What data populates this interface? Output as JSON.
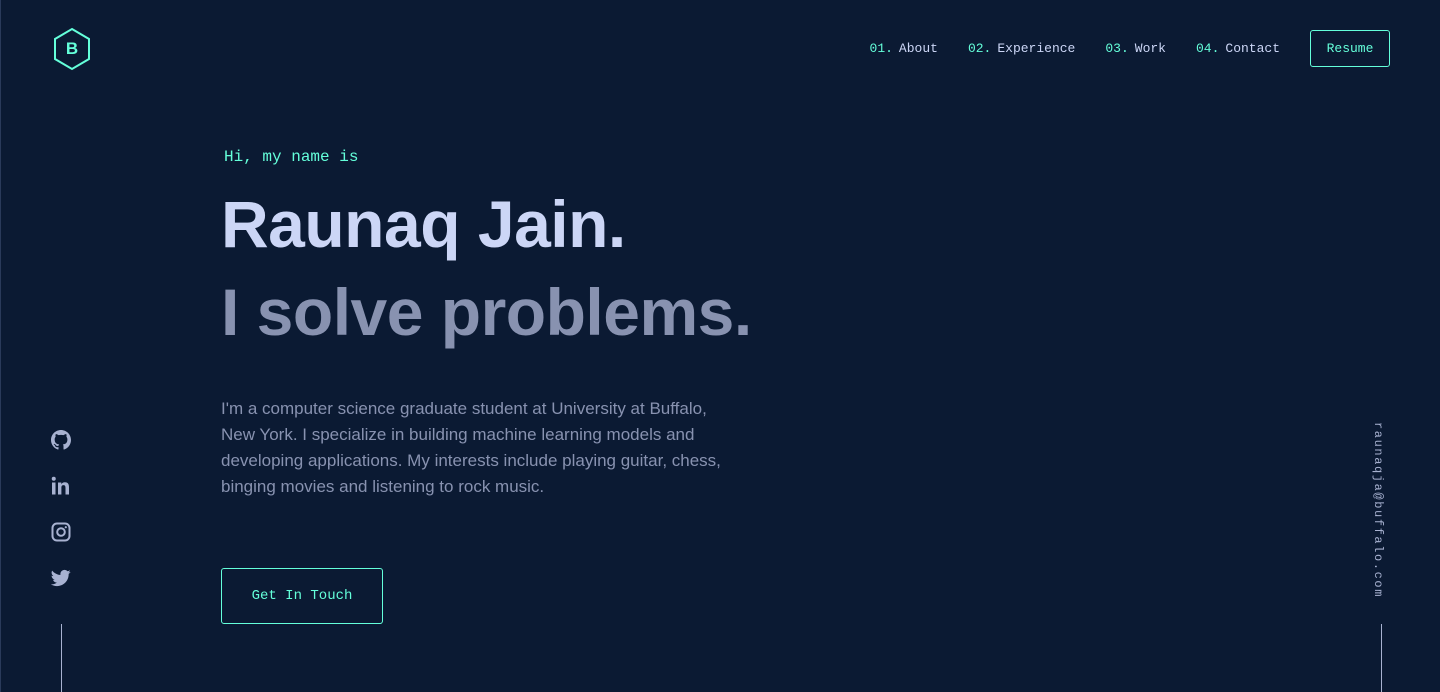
{
  "logo": {
    "letter": "B",
    "icon": "hexagon-logo-icon"
  },
  "nav": {
    "items": [
      {
        "num": "01.",
        "label": "About"
      },
      {
        "num": "02.",
        "label": "Experience"
      },
      {
        "num": "03.",
        "label": "Work"
      },
      {
        "num": "04.",
        "label": "Contact"
      }
    ],
    "resume_label": "Resume"
  },
  "hero": {
    "greeting": "Hi, my name is",
    "name": "Raunaq Jain.",
    "tagline": "I solve problems.",
    "bio": "I'm a computer science graduate student at University at Buffalo, New York. I specialize in building machine learning models and developing applications. My interests include playing guitar, chess, binging movies and listening to rock music.",
    "cta_label": "Get In Touch"
  },
  "social": {
    "icons": [
      "github-icon",
      "linkedin-icon",
      "instagram-icon",
      "twitter-icon"
    ]
  },
  "email": "raunaqja@buffalo.com",
  "colors": {
    "background": "#0b1a33",
    "accent": "#64ffda",
    "heading": "#ccd6f6",
    "text": "#8892b0"
  }
}
